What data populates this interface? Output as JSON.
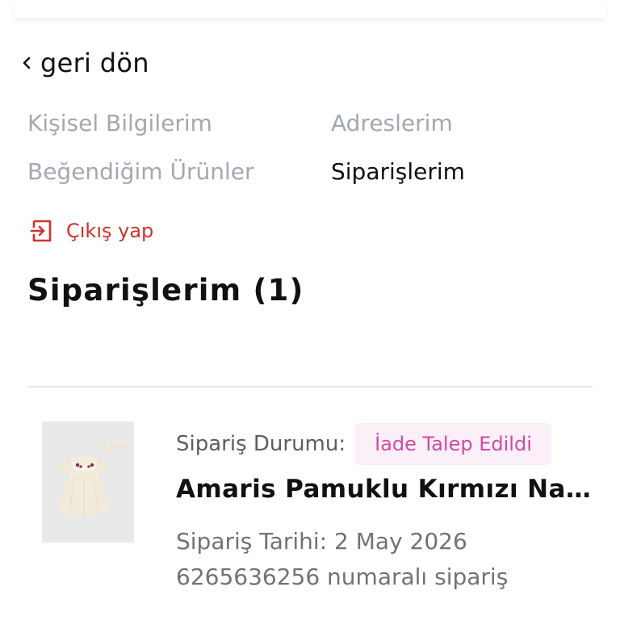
{
  "back": {
    "label": "geri dön"
  },
  "menu": {
    "personal_info": "Kişisel Bilgilerim",
    "addresses": "Adreslerim",
    "liked_products": "Beğendiğim Ürünler",
    "orders": "Siparişlerim"
  },
  "logout": {
    "label": "Çıkış yap"
  },
  "orders_section": {
    "title": "Siparişlerim (1)"
  },
  "order": {
    "status_label": "Sipariş Durumu:",
    "status_value": "İade Talep Edildi",
    "product_name": "Amaris Pamuklu Kırmızı Nakış Detaylı Elbise",
    "order_date": "Sipariş Tarihi: 2 May 2026",
    "order_number": "6265636256 numaralı sipariş"
  },
  "colors": {
    "accent_red": "#d0312d",
    "badge_bg": "#fbf0f7",
    "badge_text": "#d04aa6",
    "muted_text": "#a3a8b0"
  },
  "icons": {
    "back": "chevron-left-icon",
    "logout": "logout-icon"
  }
}
